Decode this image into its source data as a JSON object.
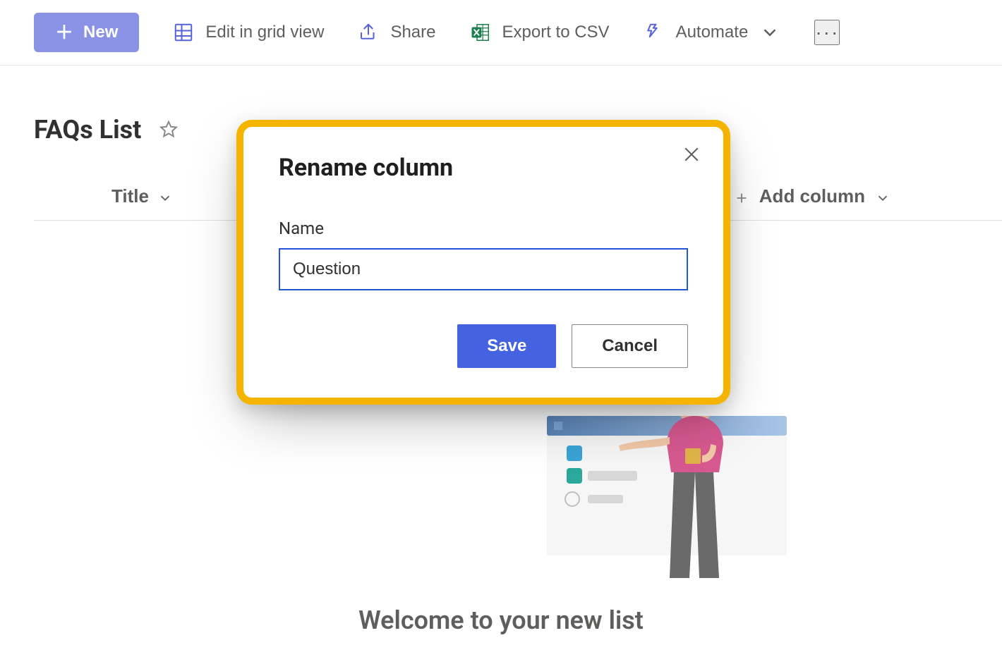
{
  "toolbar": {
    "new_label": "New",
    "edit_grid_label": "Edit in grid view",
    "share_label": "Share",
    "export_csv_label": "Export to CSV",
    "automate_label": "Automate"
  },
  "page": {
    "title": "FAQs List"
  },
  "columns": {
    "title_label": "Title",
    "add_label": "Add column"
  },
  "welcome": {
    "heading": "Welcome to your new list"
  },
  "modal": {
    "title": "Rename column",
    "field_label": "Name",
    "input_value": "Question",
    "save_label": "Save",
    "cancel_label": "Cancel"
  }
}
